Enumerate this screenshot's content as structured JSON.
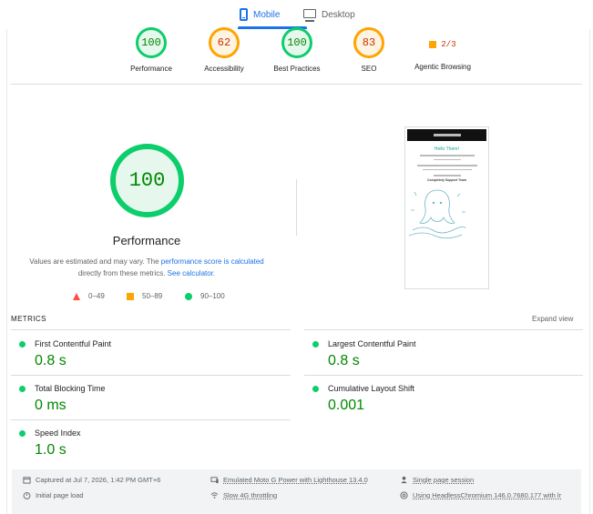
{
  "tabs": {
    "mobile": "Mobile",
    "desktop": "Desktop"
  },
  "categories": [
    {
      "score": "100",
      "label": "Performance",
      "rating": "good"
    },
    {
      "score": "62",
      "label": "Accessibility",
      "rating": "average"
    },
    {
      "score": "100",
      "label": "Best Practices",
      "rating": "good"
    },
    {
      "score": "83",
      "label": "SEO",
      "rating": "average"
    },
    {
      "score": "2/3",
      "label": "Agentic Browsing",
      "rating": "average"
    }
  ],
  "performance": {
    "score": "100",
    "title": "Performance",
    "desc_prefix": "Values are estimated and may vary. The",
    "desc_link1": "performance score is calculated",
    "desc_middle": "directly from these metrics.",
    "desc_link2": "See calculator."
  },
  "legend": {
    "poor": "0–49",
    "average": "50–89",
    "good": "90–100"
  },
  "thumbnail": {
    "hello": "Hello There!",
    "team": "Completely Support Team"
  },
  "metrics": {
    "section_label": "METRICS",
    "expand": "Expand view",
    "items": [
      {
        "name": "First Contentful Paint",
        "value": "0.8 s"
      },
      {
        "name": "Largest Contentful Paint",
        "value": "0.8 s"
      },
      {
        "name": "Total Blocking Time",
        "value": "0 ms"
      },
      {
        "name": "Cumulative Layout Shift",
        "value": "0.001"
      },
      {
        "name": "Speed Index",
        "value": "1.0 s"
      }
    ]
  },
  "footer": {
    "captured": "Captured at Jul 7, 2026, 1:42 PM GMT+6",
    "initial_load": "Initial page load",
    "device": "Emulated Moto G Power with Lighthouse 13.4.0",
    "throttling": "Slow 4G throttling",
    "session": "Single page session",
    "browser": "Using HeadlessChromium 146.0.7680.177 with lr"
  },
  "colors": {
    "accent": "#1a73e8",
    "good": "#0cce6b",
    "good_text": "#008800",
    "average": "#ffa400",
    "average_text": "#c33300",
    "poor": "#ff4e42"
  }
}
